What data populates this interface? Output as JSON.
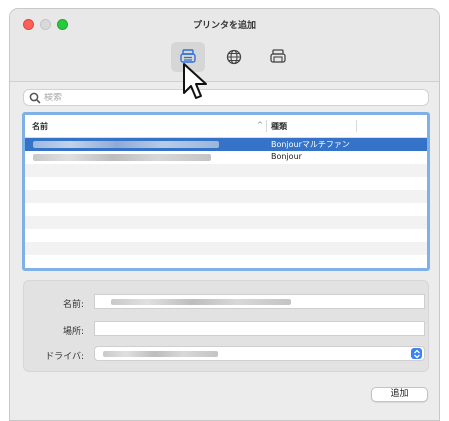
{
  "window": {
    "title": "プリンタを追加"
  },
  "toolbar": {
    "items": [
      {
        "icon": "default-printer-icon",
        "selected": true
      },
      {
        "icon": "ip-globe-icon",
        "selected": false
      },
      {
        "icon": "windows-printer-icon",
        "selected": false
      }
    ]
  },
  "search": {
    "placeholder": "検索",
    "value": ""
  },
  "table": {
    "columns": [
      "名前",
      "種類"
    ],
    "sort_indicator": "^",
    "rows": [
      {
        "name": "",
        "kind": "Bonjourマルチファン",
        "selected": true
      },
      {
        "name": "",
        "kind": "Bonjour",
        "selected": false
      }
    ]
  },
  "details": {
    "name_label": "名前:",
    "location_label": "場所:",
    "location_value": "",
    "driver_label": "ドライバ:"
  },
  "footer": {
    "add_button": "追加"
  },
  "colors": {
    "selection": "#3573c9",
    "focus_ring": "#7fb0e6",
    "close": "#fe5f57",
    "maximize": "#27c93f"
  }
}
